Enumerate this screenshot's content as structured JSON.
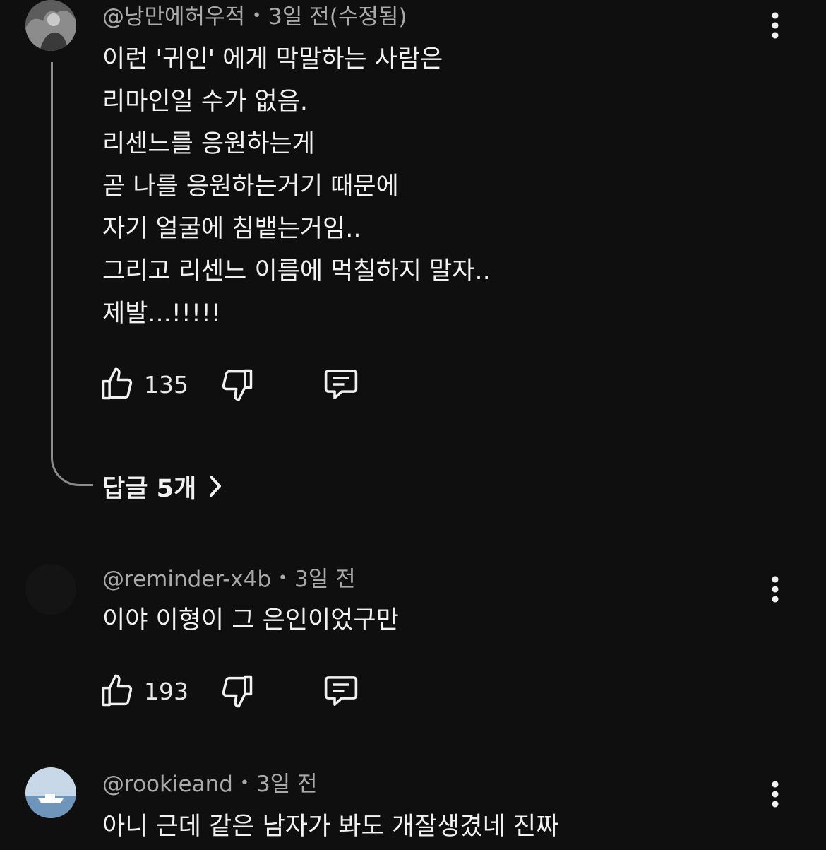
{
  "comments": [
    {
      "author": "@낭만에허우적",
      "time": "3일 전(수정됨)",
      "text": [
        "이런 '귀인' 에게 막말하는 사람은",
        "리마인일 수가 없음.",
        "리센느를 응원하는게",
        "곧 나를 응원하는거기 때문에",
        "자기 얼굴에 침뱉는거임..",
        "그리고 리센느 이름에 먹칠하지 말자..",
        "제발...!!!!!"
      ],
      "likes": "135",
      "replies_label": "답글 5개"
    },
    {
      "author": "@reminder-x4b",
      "time": "3일 전",
      "text": [
        "이야 이형이 그 은인이었구만"
      ],
      "likes": "193"
    },
    {
      "author": "@rookieand",
      "time": "3일 전",
      "text": [
        "아니 근데 같은 남자가 봐도 개잘생겼네 진짜"
      ]
    }
  ],
  "separator": "•",
  "icons": {
    "like": "thumbs-up-icon",
    "dislike": "thumbs-down-icon",
    "reply": "comment-icon",
    "more": "more-vertical-icon",
    "expand": "chevron-right-icon"
  },
  "colors": {
    "background": "#0f0f0f",
    "text": "#f1f1f1",
    "meta": "#aaaaaa",
    "thread_line": "#8a8a8a"
  }
}
